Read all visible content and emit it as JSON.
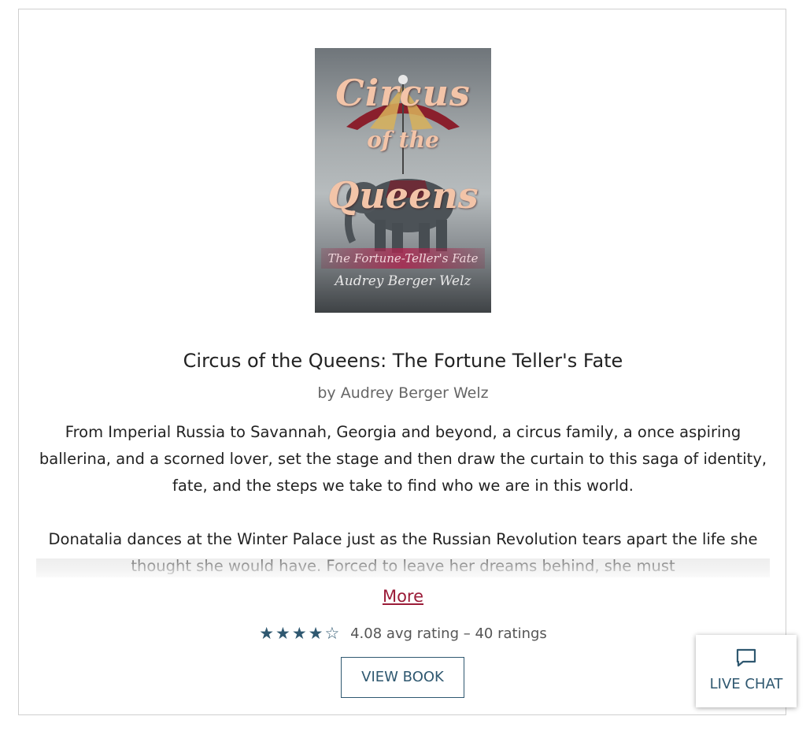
{
  "cover": {
    "title_line1": "Circus",
    "title_line2": "of the",
    "title_line3": "Queens",
    "subtitle": "The Fortune-Teller's Fate",
    "author": "Audrey Berger Welz"
  },
  "book": {
    "title": "Circus of the Queens: The Fortune Teller's Fate",
    "author_line": "by Audrey Berger Welz",
    "description_paragraph_1": "From Imperial Russia to Savannah, Georgia and beyond, a circus family, a once aspiring ballerina, and a scorned lover, set the stage and then draw the curtain to this saga of identity, fate, and the steps we take to find who we are in this world.",
    "description_paragraph_2": "Donatalia dances at the Winter Palace just as the Russian Revolution tears apart the life she thought she would have. Forced to leave her dreams behind, she must"
  },
  "more_link": "More",
  "rating": {
    "stars_filled": 4,
    "stars_total": 5,
    "stars_display": "★★★★☆",
    "text": "4.08 avg rating – 40 ratings"
  },
  "view_book_button": "VIEW BOOK",
  "live_chat": {
    "label": "LIVE CHAT",
    "icon": "chat-bubble-icon"
  },
  "colors": {
    "accent": "#2f5870",
    "link": "#9b1c38"
  }
}
